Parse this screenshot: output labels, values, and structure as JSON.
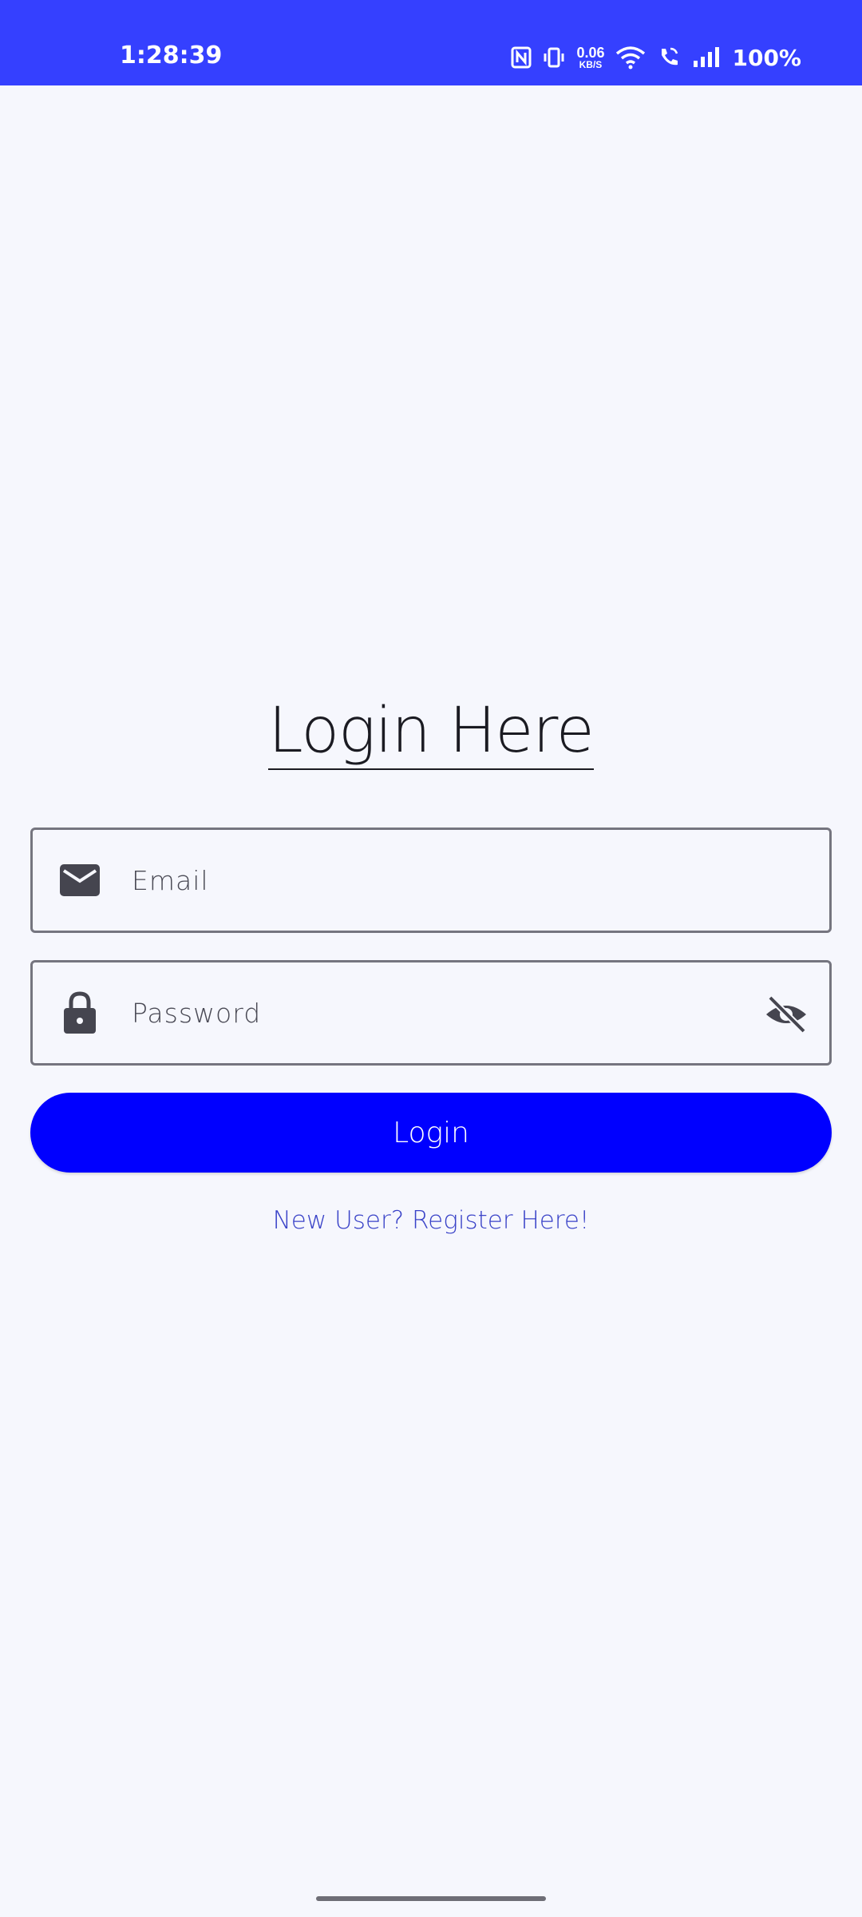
{
  "status_bar": {
    "time": "1:28:39",
    "net_speed_value": "0.06",
    "net_speed_unit": "KB/S",
    "battery": "100%",
    "icons": [
      "nfc-icon",
      "vibrate-icon",
      "wifi-icon",
      "wifi-call-icon",
      "signal-icon"
    ],
    "background_color": "#3540FF"
  },
  "login": {
    "title": "Login Here",
    "email": {
      "placeholder": "Email",
      "icon": "mail-icon"
    },
    "password": {
      "placeholder": "Password",
      "icon": "lock-icon",
      "toggle_icon": "visibility-off-icon"
    },
    "submit_label": "Login",
    "register_link": "New User? Register Here!",
    "accent_color": "#0000FF"
  }
}
